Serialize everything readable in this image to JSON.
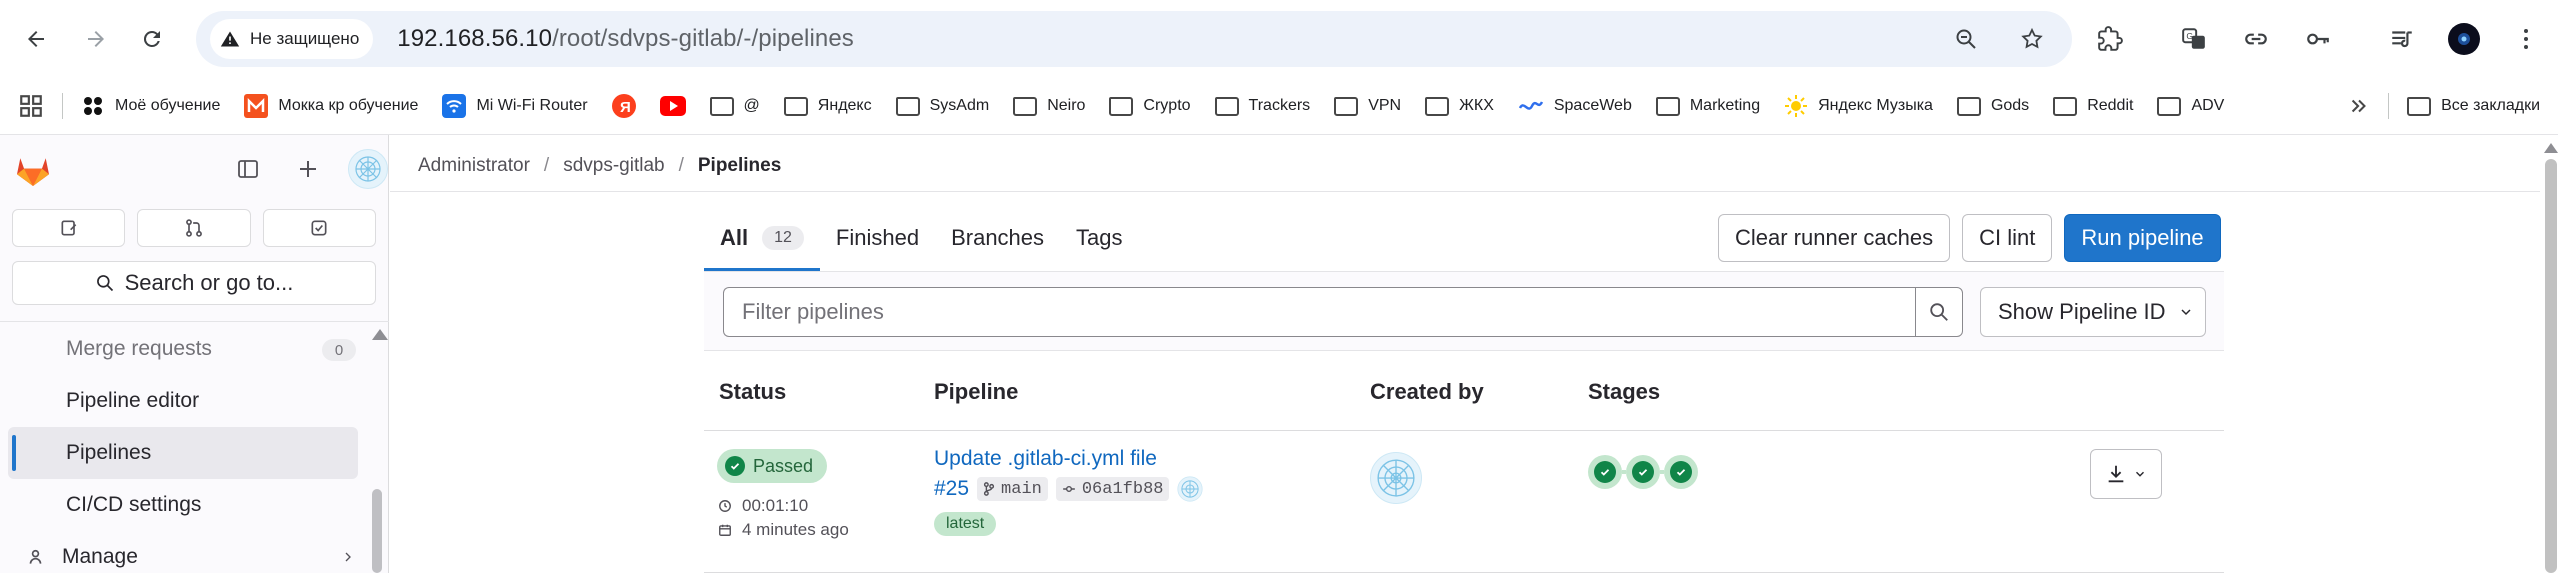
{
  "browser": {
    "security_label": "Не защищено",
    "url_host": "192.168.56.10",
    "url_path": "/root/sdvps-gitlab/-/pipelines",
    "bookmarks": [
      {
        "label": "Моё обучение",
        "icon": "app-icon"
      },
      {
        "label": "Мокка кр обучение",
        "icon": "m-logo-icon"
      },
      {
        "label": "Mi Wi-Fi Router",
        "icon": "wifi-icon"
      },
      {
        "label": "",
        "icon": "yandex-icon"
      },
      {
        "label": "",
        "icon": "youtube-icon"
      },
      {
        "label": "@",
        "icon": "folder-icon"
      },
      {
        "label": "Яндекс",
        "icon": "folder-icon"
      },
      {
        "label": "SysAdm",
        "icon": "folder-icon"
      },
      {
        "label": "Neiro",
        "icon": "folder-icon"
      },
      {
        "label": "Crypto",
        "icon": "folder-icon"
      },
      {
        "label": "Trackers",
        "icon": "folder-icon"
      },
      {
        "label": "VPN",
        "icon": "folder-icon"
      },
      {
        "label": "ЖКХ",
        "icon": "folder-icon"
      },
      {
        "label": "SpaceWeb",
        "icon": "spaceweb-icon"
      },
      {
        "label": "Marketing",
        "icon": "folder-icon"
      },
      {
        "label": "Яндекс Музыка",
        "icon": "sun-icon"
      },
      {
        "label": "Gods",
        "icon": "folder-icon"
      },
      {
        "label": "Reddit",
        "icon": "folder-icon"
      },
      {
        "label": "ADV",
        "icon": "folder-icon"
      }
    ],
    "all_bookmarks": "Все закладки"
  },
  "sidebar": {
    "search_label": "Search or go to...",
    "items": [
      {
        "label": "Merge requests",
        "count": "0",
        "state": "faded"
      },
      {
        "label": "Pipeline editor",
        "state": "normal"
      },
      {
        "label": "Pipelines",
        "state": "active"
      },
      {
        "label": "CI/CD settings",
        "state": "normal"
      },
      {
        "label": "Manage",
        "state": "section"
      }
    ]
  },
  "breadcrumb": {
    "items": [
      "Administrator",
      "sdvps-gitlab",
      "Pipelines"
    ]
  },
  "tabs": [
    {
      "label": "All",
      "count": "12",
      "active": true
    },
    {
      "label": "Finished"
    },
    {
      "label": "Branches"
    },
    {
      "label": "Tags"
    }
  ],
  "actions": {
    "clear_caches": "Clear runner caches",
    "ci_lint": "CI lint",
    "run_pipeline": "Run pipeline"
  },
  "filter": {
    "placeholder": "Filter pipelines",
    "show_id": "Show Pipeline ID"
  },
  "table": {
    "headers": [
      "Status",
      "Pipeline",
      "Created by",
      "Stages"
    ],
    "rows": [
      {
        "status": "Passed",
        "duration": "00:01:10",
        "finished": "4 minutes ago",
        "title": "Update .gitlab-ci.yml file",
        "id": "#25",
        "branch": "main",
        "commit": "06a1fb88",
        "tag": "latest",
        "stages": [
          "passed",
          "passed",
          "passed"
        ]
      }
    ]
  },
  "colors": {
    "accent": "#1f75cb",
    "success": "#108548",
    "success_bg": "#c3e6cd"
  }
}
